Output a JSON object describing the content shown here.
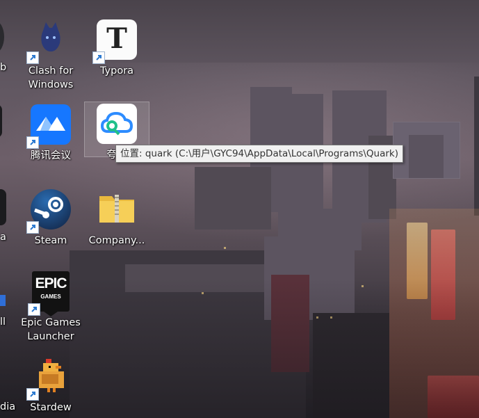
{
  "desktop": {
    "icons": [
      {
        "label": "Clash for\nWindows",
        "icon": "clash-cat-icon"
      },
      {
        "label": "Typora",
        "icon": "typora-t-icon",
        "glyph": "T"
      },
      {
        "label": "腾讯会议",
        "icon": "tencent-meeting-icon"
      },
      {
        "label": "夸克",
        "icon": "quark-cloud-icon"
      },
      {
        "label": "Steam",
        "icon": "steam-icon"
      },
      {
        "label": "Company...",
        "icon": "zip-folder-icon"
      },
      {
        "label": "Epic Games\nLauncher",
        "icon": "epic-games-icon",
        "glyph": "EPIC",
        "sub": "GAMES"
      },
      {
        "label": "Stardew",
        "icon": "stardew-chicken-icon"
      }
    ],
    "partial_left_labels": [
      "b",
      "a",
      "ll",
      "dia"
    ]
  },
  "tooltip": {
    "text": "位置: quark (C:\\用户\\GYC94\\AppData\\Local\\Programs\\Quark)"
  },
  "colors": {
    "shortcut_arrow": "#2b79d0",
    "tooltip_bg": "#f1f1f1"
  }
}
